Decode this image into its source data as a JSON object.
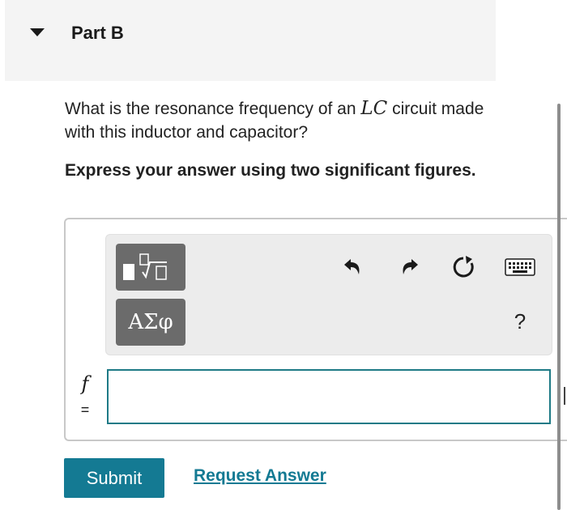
{
  "part": {
    "title": "Part B"
  },
  "question": {
    "text_before": "What is the resonance frequency of an ",
    "math": "LC",
    "text_after": " circuit made with this inductor and capacitor?"
  },
  "instruction": "Express your answer using two significant figures.",
  "toolbar": {
    "template_icon": "templates-sqrt-icon",
    "greek_label": "ΑΣφ",
    "undo_icon": "undo-icon",
    "redo_icon": "redo-icon",
    "reset_icon": "reset-icon",
    "keyboard_icon": "keyboard-icon",
    "help_label": "?"
  },
  "answer": {
    "variable": "f",
    "equals": "=",
    "value": ""
  },
  "actions": {
    "submit_label": "Submit",
    "request_label": "Request Answer"
  },
  "colors": {
    "accent": "#147a93",
    "input_border": "#1e7a86",
    "toolbar_button": "#6b6b6b",
    "header_bg": "#f4f4f4"
  }
}
